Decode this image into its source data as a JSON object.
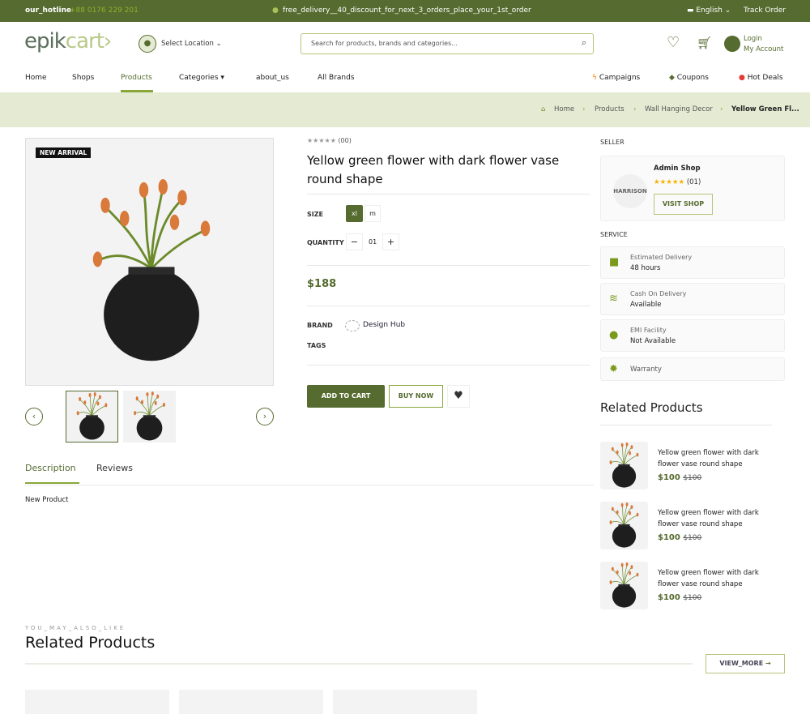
{
  "colors": {
    "brand": "#556b2f",
    "accent_light": "#e5ebd3",
    "hotline": "#8db32b"
  },
  "topbar": {
    "hotline_label": "our_hotline",
    "hotline_number": "+88 0176 229 201",
    "promo": "free_delivery__40_discount_for_next_3_orders_place_your_1st_order",
    "language": "English",
    "track_order": "Track Order"
  },
  "header": {
    "logo_a": "epik",
    "logo_b": "cart",
    "location": "Select Location",
    "search_placeholder": "Search for products, brands and categories...",
    "login": "Login",
    "account": "My Account"
  },
  "nav": {
    "items": [
      "Home",
      "Shops",
      "Products",
      "Categories",
      "about_us",
      "All Brands"
    ],
    "active": "Products",
    "right": [
      "Campaigns",
      "Coupons",
      "Hot Deals"
    ]
  },
  "breadcrumb": [
    "Home",
    "Products",
    "Wall Hanging Decor",
    "Yellow Green Fl..."
  ],
  "product": {
    "badge": "NEW ARRIVAL",
    "rating_count": "(00)",
    "title": "Yellow green flower with dark flower vase round shape",
    "size_label": "SIZE",
    "sizes": [
      "xl",
      "m"
    ],
    "selected_size": "xl",
    "qty_label": "QUANTITY",
    "qty": "01",
    "price": "$188",
    "brand_label": "BRAND",
    "brand": "Design Hub",
    "tags_label": "TAGS",
    "add_to_cart": "ADD TO CART",
    "buy_now": "BUY NOW"
  },
  "tabs": {
    "items": [
      "Description",
      "Reviews"
    ],
    "active": "Description",
    "content": "New Product"
  },
  "seller": {
    "heading": "SELLER",
    "name": "Admin Shop",
    "rating": 5,
    "rating_count": "(01)",
    "visit": "VISIT SHOP",
    "logo_text": "HARRISON"
  },
  "service": {
    "heading": "SERVICE",
    "items": [
      {
        "title": "Estimated Delivery",
        "value": "48 hours",
        "icon": "truck-icon"
      },
      {
        "title": "Cash On Delivery",
        "value": "Available",
        "icon": "coins-icon"
      },
      {
        "title": "EMI Facility",
        "value": "Not Available",
        "icon": "piggy-bank-icon"
      },
      {
        "title": "Warranty",
        "value": "",
        "icon": "gear-icon"
      }
    ]
  },
  "side_related": {
    "heading": "Related Products",
    "items": [
      {
        "name": "Yellow green flower with dark flower vase round shape",
        "price": "$100",
        "old": "$100"
      },
      {
        "name": "Yellow green flower with dark flower vase round shape",
        "price": "$100",
        "old": "$100"
      },
      {
        "name": "Yellow green flower with dark flower vase round shape",
        "price": "$100",
        "old": "$100"
      }
    ]
  },
  "bottom": {
    "eyebrow": "YOU_MAY_ALSO_LIKE",
    "heading": "Related Products",
    "view_more": "VIEW_MORE"
  }
}
